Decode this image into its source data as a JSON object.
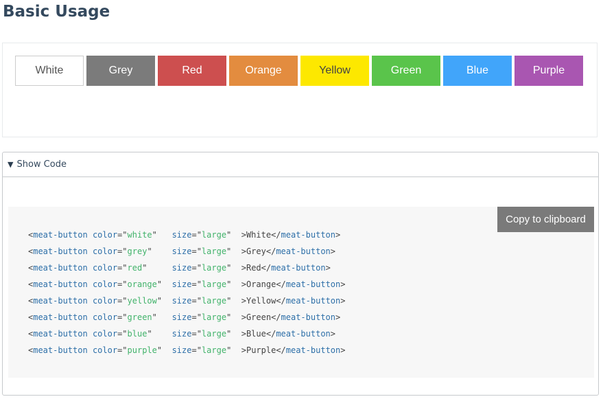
{
  "page": {
    "title": "Basic Usage"
  },
  "buttons": [
    {
      "label": "White",
      "bg": "#ffffff",
      "fg": "#555555",
      "border": "#cccccc"
    },
    {
      "label": "Grey",
      "bg": "#7b7b7b",
      "fg": "#ffffff",
      "border": "#7b7b7b"
    },
    {
      "label": "Red",
      "bg": "#cd4f4f",
      "fg": "#ffffff",
      "border": "#cd4f4f"
    },
    {
      "label": "Orange",
      "bg": "#e38c3f",
      "fg": "#ffffff",
      "border": "#e38c3f"
    },
    {
      "label": "Yellow",
      "bg": "#fde800",
      "fg": "#444444",
      "border": "#fde800"
    },
    {
      "label": "Green",
      "bg": "#5ac44b",
      "fg": "#ffffff",
      "border": "#5ac44b"
    },
    {
      "label": "Blue",
      "bg": "#41a5fa",
      "fg": "#ffffff",
      "border": "#41a5fa"
    },
    {
      "label": "Purple",
      "bg": "#a956b1",
      "fg": "#ffffff",
      "border": "#a956b1"
    }
  ],
  "code": {
    "toggle_label": "Show Code",
    "toggle_icon": "triangle-down-icon",
    "copy_label": "Copy to clipboard",
    "tag_name": "meat-button",
    "lines": [
      {
        "color": "white",
        "size": "large",
        "text": "White"
      },
      {
        "color": "grey",
        "size": "large",
        "text": "Grey"
      },
      {
        "color": "red",
        "size": "large",
        "text": "Red"
      },
      {
        "color": "orange",
        "size": "large",
        "text": "Orange"
      },
      {
        "color": "yellow",
        "size": "large",
        "text": "Yellow"
      },
      {
        "color": "green",
        "size": "large",
        "text": "Green"
      },
      {
        "color": "blue",
        "size": "large",
        "text": "Blue"
      },
      {
        "color": "purple",
        "size": "large",
        "text": "Purple"
      }
    ]
  }
}
